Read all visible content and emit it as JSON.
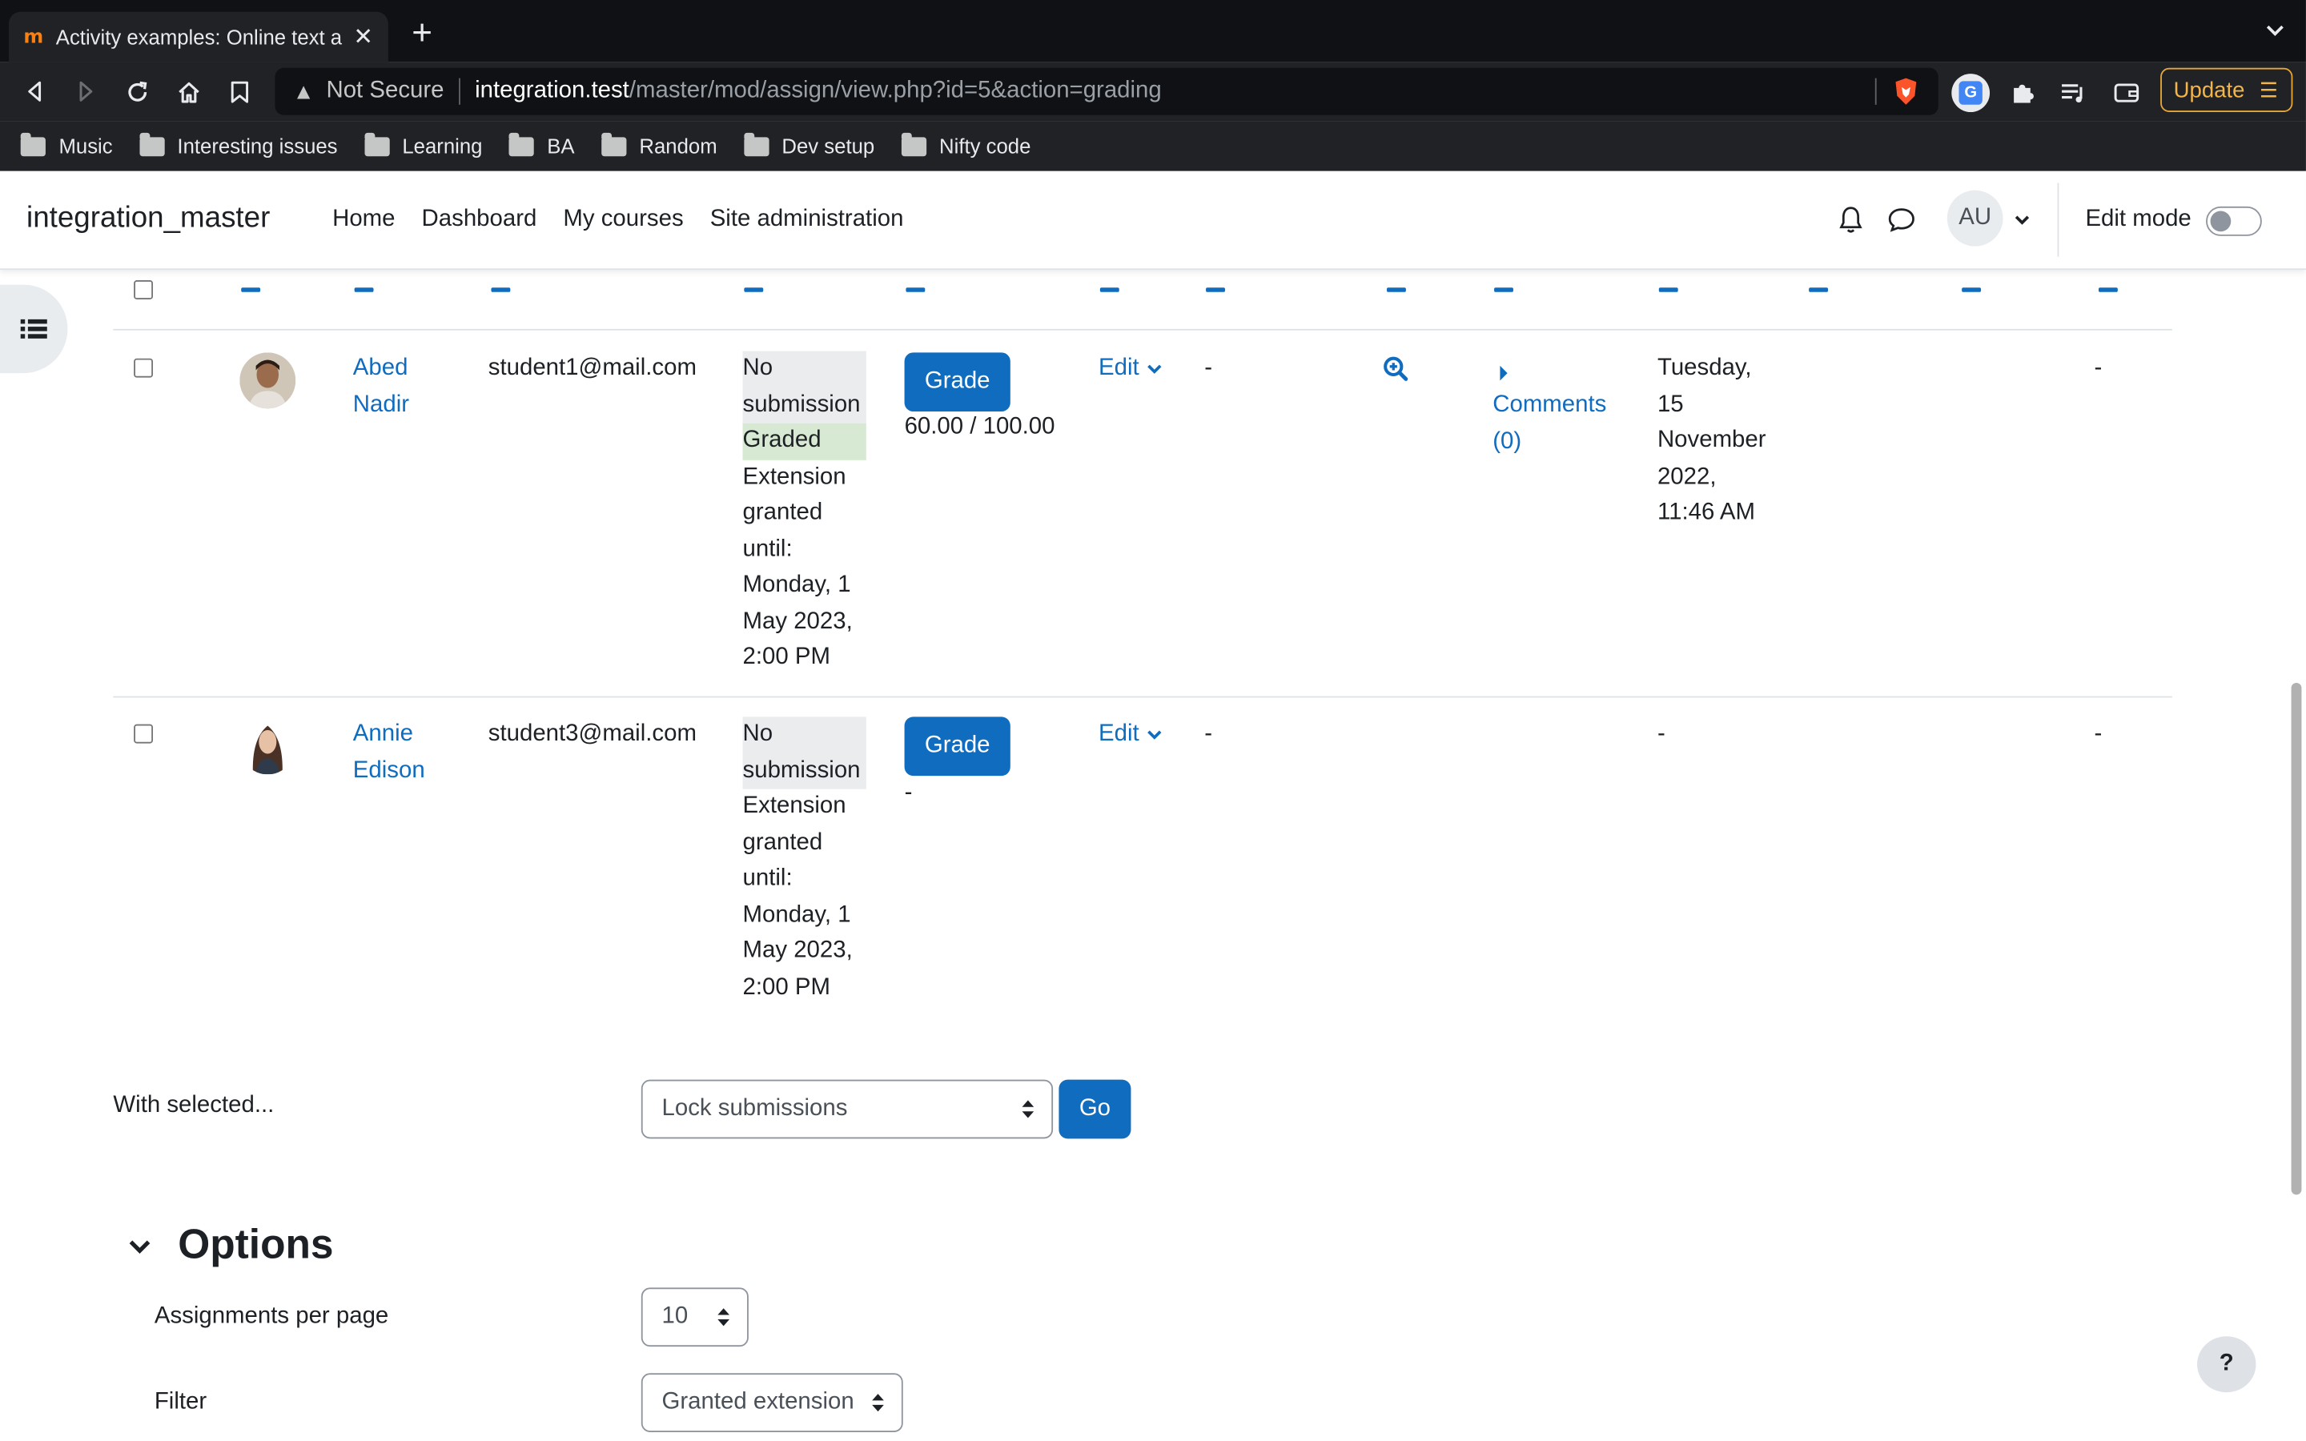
{
  "browser": {
    "tab_title": "Activity examples: Online text a",
    "favicon": "m",
    "security_label": "Not Secure",
    "url_host": "integration.test",
    "url_path": "/master/mod/assign/view.php?id=5&action=grading",
    "update_label": "Update",
    "bookmarks": [
      "Music",
      "Interesting issues",
      "Learning",
      "BA",
      "Random",
      "Dev setup",
      "Nifty code"
    ]
  },
  "navbar": {
    "site_name": "integration_master",
    "nav_items": [
      "Home",
      "Dashboard",
      "My courses",
      "Site administration"
    ],
    "user_initials": "AU",
    "edit_mode_label": "Edit mode"
  },
  "rows": [
    {
      "first_name": "Abed",
      "last_name": "Nadir",
      "email": "student1@mail.com",
      "status_lines": [
        "No",
        "submission"
      ],
      "graded_label": "Graded",
      "extension_lines": [
        "Extension",
        "granted",
        "until:",
        "Monday, 1",
        "May 2023,",
        "2:00 PM"
      ],
      "grade_button": "Grade",
      "grade_value": "60.00 / 100.00",
      "edit_label": "Edit",
      "last_modified": "-",
      "comments_lines": [
        "Comments",
        "(0)"
      ],
      "graded_date_lines": [
        "Tuesday,",
        "15",
        "November",
        "2022,",
        "11:46 AM"
      ],
      "final_grade": "-"
    },
    {
      "first_name": "Annie",
      "last_name": "Edison",
      "email": "student3@mail.com",
      "status_lines": [
        "No",
        "submission"
      ],
      "extension_lines": [
        "Extension",
        "granted",
        "until:",
        "Monday, 1",
        "May 2023,",
        "2:00 PM"
      ],
      "grade_button": "Grade",
      "grade_value": "-",
      "edit_label": "Edit",
      "last_modified": "-",
      "graded_date": "-",
      "final_grade": "-"
    }
  ],
  "bulk": {
    "with_selected_label": "With selected...",
    "action_value": "Lock submissions",
    "go_label": "Go"
  },
  "options": {
    "title": "Options",
    "per_page_label": "Assignments per page",
    "per_page_value": "10",
    "filter_label": "Filter",
    "filter_value": "Granted extension"
  },
  "help_label": "?"
}
